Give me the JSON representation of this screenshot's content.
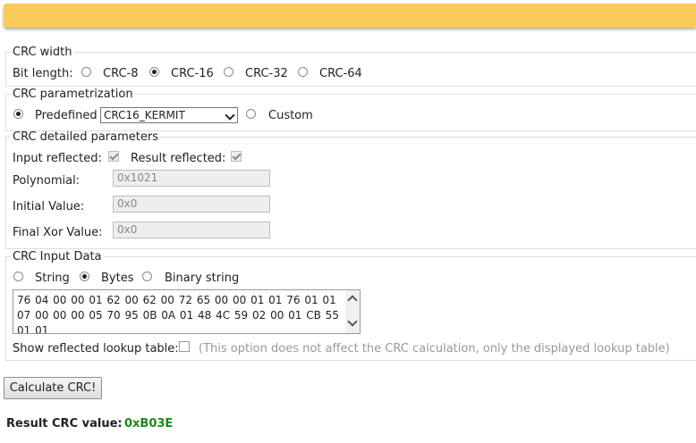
{
  "crc_width": {
    "legend": "CRC width",
    "bit_length_label": "Bit length:",
    "options": [
      {
        "label": "CRC-8",
        "selected": false
      },
      {
        "label": "CRC-16",
        "selected": true
      },
      {
        "label": "CRC-32",
        "selected": false
      },
      {
        "label": "CRC-64",
        "selected": false
      }
    ]
  },
  "crc_param": {
    "legend": "CRC parametrization",
    "predefined_label": "Predefined",
    "selected_algorithm": "CRC16_KERMIT",
    "custom_label": "Custom"
  },
  "crc_details": {
    "legend": "CRC detailed parameters",
    "input_reflected_label": "Input reflected:",
    "result_reflected_label": "Result reflected:",
    "polynomial_label": "Polynomial:",
    "polynomial_value": "0x1021",
    "initial_label": "Initial Value:",
    "initial_value": "0x0",
    "final_xor_label": "Final Xor Value:",
    "final_xor_value": "0x0"
  },
  "crc_input": {
    "legend": "CRC Input Data",
    "options": [
      "String",
      "Bytes",
      "Binary string"
    ],
    "data": "76 04 00 00 01 62 00 62 00 72 65 00 00 01 01 76 01 01 07 00 00 00 05 70 95 0B 0A 01 48 4C 59 02 00 01 CB 55 01 01",
    "lookup_label": "Show reflected lookup table:",
    "lookup_note": "(This option does not affect the CRC calculation, only the displayed lookup table)"
  },
  "actions": {
    "calculate_label": "Calculate CRC!"
  },
  "result": {
    "label": "Result CRC value:",
    "value": "0xB03E"
  },
  "colors": {
    "header": "#f9c95a",
    "result_value": "#1a8a1a"
  }
}
